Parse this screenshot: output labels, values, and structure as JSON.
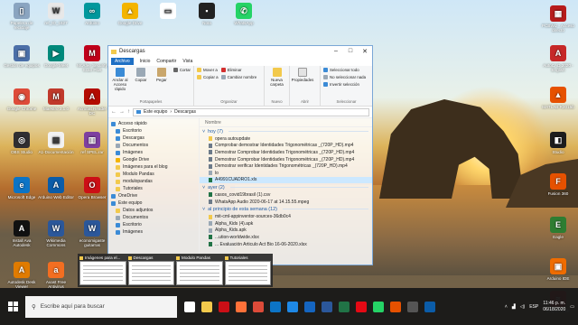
{
  "desktop_icons": [
    {
      "label": "Papelera de reciclaje",
      "color": "#8aa4c0",
      "glyph": "▯"
    },
    {
      "label": "ref_ID_1627",
      "color": "#e8e8e8",
      "glyph": "W"
    },
    {
      "label": "Arduino",
      "color": "#00979c",
      "glyph": "∞"
    },
    {
      "label": "Google Drive",
      "color": "#f4b400",
      "glyph": "▲"
    },
    {
      "label": "",
      "color": "#ffffff",
      "glyph": "▭"
    },
    {
      "label": "Nota",
      "color": "#222222",
      "glyph": "▪"
    },
    {
      "label": "WhatsApp",
      "color": "#25d366",
      "glyph": "✆"
    },
    {
      "label": "Gestión de equipos",
      "color": "#4b6fa8",
      "glyph": "▣"
    },
    {
      "label": "Google Meet",
      "color": "#00897b",
      "glyph": "▶"
    },
    {
      "label": "McAfee Security Scan Plus",
      "color": "#c0001a",
      "glyph": "M"
    },
    {
      "label": "Google Chrome",
      "color": "#dd4b39",
      "glyph": "◉"
    },
    {
      "label": "Maestro 2.1.0",
      "color": "#c0392b",
      "glyph": "M"
    },
    {
      "label": "Acrobat Reader DC",
      "color": "#b30b00",
      "glyph": "A"
    },
    {
      "label": "OBS Studio",
      "color": "#302e31",
      "glyph": "◎"
    },
    {
      "label": "A1-Documentación",
      "color": "#f2f2f2",
      "glyph": "▤"
    },
    {
      "label": "ref SPEL.rar",
      "color": "#7e3fa0",
      "glyph": "▥"
    },
    {
      "label": "Microsoft Edge",
      "color": "#0c74c6",
      "glyph": "e"
    },
    {
      "label": "Arduino Web Editor",
      "color": "#0b5ca8",
      "glyph": "A"
    },
    {
      "label": "Opera Browser",
      "color": "#cc0f16",
      "glyph": "O"
    },
    {
      "label": "Install Ava Autodesk",
      "color": "#111111",
      "glyph": "A"
    },
    {
      "label": "Wikimedia Commons",
      "color": "#2b579a",
      "glyph": "W"
    },
    {
      "label": "economigaste guitarras",
      "color": "#2b579a",
      "glyph": "W"
    },
    {
      "label": "Autodesk Desk Viewer",
      "color": "#e07b00",
      "glyph": "A"
    },
    {
      "label": "Avast Free Antivirus",
      "color": "#f36e21",
      "glyph": "a"
    },
    {
      "label": "PCBWiz - Acceso directo",
      "color": "#b71c1c",
      "glyph": "▦"
    },
    {
      "label": "AutoCAD 2020 - English",
      "color": "#c62828",
      "glyph": "A"
    },
    {
      "label": "MATLAB R2015b",
      "color": "#e65100",
      "glyph": "▲"
    },
    {
      "label": "Studio",
      "color": "#1d1d1d",
      "glyph": "◧"
    },
    {
      "label": "Fusion 360",
      "color": "#e65100",
      "glyph": "F"
    },
    {
      "label": "Eagle",
      "color": "#2e7d32",
      "glyph": "E"
    },
    {
      "label": "Arduino IDE",
      "color": "#ef6c00",
      "glyph": "▣"
    },
    {
      "label": "LTspice XVII",
      "color": "#b71c1c",
      "glyph": "≈"
    }
  ],
  "explorer": {
    "title": "Descargas",
    "ribbon_tabs": [
      "Archivo",
      "Inicio",
      "Compartir",
      "Vista"
    ],
    "ribbon": {
      "clipboard": {
        "caption": "Portapapeles",
        "pin": "Anclar al Acceso rápido",
        "copy": "Copiar",
        "paste": "Pegar",
        "cut": "Cortar",
        "copy_path": "Copiar ruta de acceso",
        "paste_shortcut": "Pegar acceso directo"
      },
      "organize": {
        "caption": "Organizar",
        "move": "Mover a",
        "copy_to": "Copiar a",
        "delete": "Eliminar",
        "rename": "Cambiar nombre"
      },
      "new": {
        "caption": "Nuevo",
        "new_folder": "Nueva carpeta"
      },
      "open": {
        "caption": "Abrir",
        "properties": "Propiedades"
      },
      "select": {
        "caption": "Seleccionar",
        "all": "Seleccionar todo",
        "none": "No seleccionar nada",
        "invert": "Invertir selección"
      }
    },
    "address": {
      "pc": "Este equipo",
      "folder": "Descargas"
    },
    "nav": [
      {
        "label": "Acceso rápido",
        "top": true,
        "color": "#3b8bd6"
      },
      {
        "label": "Escritorio",
        "color": "#3b8bd6"
      },
      {
        "label": "Descargas",
        "color": "#3b8bd6"
      },
      {
        "label": "Documentos",
        "color": "#9aa8b5"
      },
      {
        "label": "Imágenes",
        "color": "#3b8bd6"
      },
      {
        "label": "Google Drive",
        "color": "#f4b400"
      },
      {
        "label": "Imágenes para el blog",
        "color": "#f2c94c"
      },
      {
        "label": "Modulo Pandas",
        "color": "#f2c94c"
      },
      {
        "label": "modulopandas",
        "color": "#f2c94c"
      },
      {
        "label": "Tutoriales",
        "color": "#f2c94c"
      },
      {
        "label": "OneDrive",
        "top": true,
        "color": "#3b8bd6"
      },
      {
        "label": "Este equipo",
        "top": true,
        "color": "#3b8bd6"
      },
      {
        "label": "Datos adjuntos",
        "color": "#f2c94c"
      },
      {
        "label": "Documentos",
        "color": "#9aa8b5"
      },
      {
        "label": "Escritorio",
        "color": "#3b8bd6"
      },
      {
        "label": "Imágenes",
        "color": "#3b8bd6"
      }
    ],
    "column_name": "Nombre",
    "groups": [
      {
        "label": "hoy (7)",
        "files": [
          {
            "name": "opera autoupdate",
            "color": "#f2c94c"
          },
          {
            "name": "Comprobar demostrar Identidades Trigonométricas _(720P_HD).mp4",
            "color": "#6c7a89"
          },
          {
            "name": "Demostrar Comprobar Identidades Trigonométricas _(720P_HD).mp4",
            "color": "#6c7a89"
          },
          {
            "name": "Demostrar Comprobar Identidades Trigonométricas _(720P_HD).mp4",
            "color": "#6c7a89"
          },
          {
            "name": "Demostrar verificar Identidades Trigonométricas _(720P_HD).mp4",
            "color": "#6c7a89"
          },
          {
            "name": "lo",
            "color": "#9aa8b5"
          },
          {
            "name": "A4991CUADRO1.xls",
            "color": "#217346",
            "selected": true
          }
        ]
      },
      {
        "label": "ayer (2)",
        "files": [
          {
            "name": "casos_covid19brasil (1).csv",
            "color": "#217346"
          },
          {
            "name": "WhatsApp Audio 2020-06-17 at 14.15.55.mpeg",
            "color": "#6c7a89"
          }
        ]
      },
      {
        "label": "al principio de esta semana (12)",
        "files": [
          {
            "name": "mit-cml-appinventor-sources-36db0c4",
            "color": "#f2c94c"
          },
          {
            "name": "Alpha_Kids (4).apk",
            "color": "#9aa8b5"
          },
          {
            "name": "Alpha_Kids.apk",
            "color": "#9aa8b5"
          },
          {
            "name": "...ution-worldwide.xlsx",
            "color": "#217346"
          },
          {
            "name": "... Evaluación Articulo Act Bio 16-06-2020.xlsx",
            "color": "#217346"
          }
        ]
      }
    ]
  },
  "thumbnails": [
    "Imágenes para el...",
    "Descargas",
    "Modulo Pandas",
    "Tutoriales"
  ],
  "taskbar": {
    "search_placeholder": "Escribe aquí para buscar",
    "pinned": [
      {
        "name": "task-view",
        "color": "#ffffff"
      },
      {
        "name": "explorer",
        "color": "#f2c94c"
      },
      {
        "name": "opera",
        "color": "#cc0f16"
      },
      {
        "name": "firefox",
        "color": "#ff7139"
      },
      {
        "name": "chrome",
        "color": "#dd4b39"
      },
      {
        "name": "edge",
        "color": "#0c74c6"
      },
      {
        "name": "store",
        "color": "#1e88e5"
      },
      {
        "name": "mail",
        "color": "#1565c0"
      },
      {
        "name": "word",
        "color": "#2b579a"
      },
      {
        "name": "excel",
        "color": "#217346"
      },
      {
        "name": "netflix",
        "color": "#e50914"
      },
      {
        "name": "whatsapp",
        "color": "#25d366"
      },
      {
        "name": "matlab",
        "color": "#e65100"
      },
      {
        "name": "obs",
        "color": "#555555"
      },
      {
        "name": "photos",
        "color": "#0b5ca8"
      }
    ],
    "lang": "ESP",
    "time": "11:46 p. m.",
    "date": "06/18/2020"
  }
}
